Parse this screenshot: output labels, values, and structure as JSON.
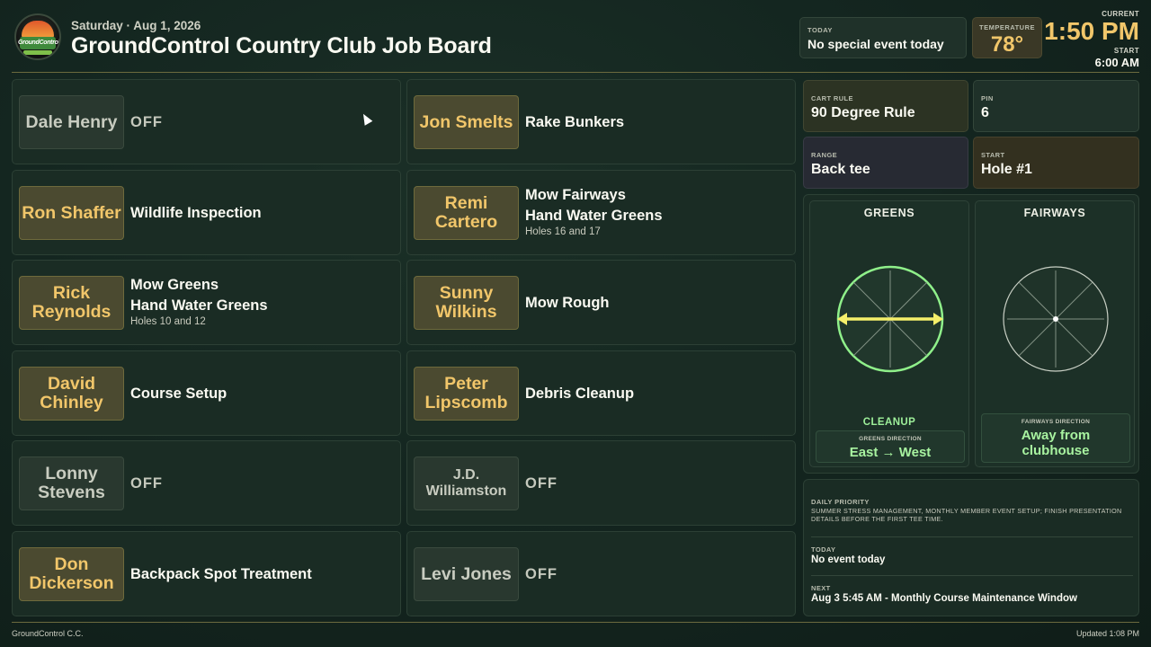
{
  "header": {
    "date": "Saturday · Aug 1, 2026",
    "title": "GroundControl Country Club Job Board",
    "logo_text": "GroundControl",
    "today_label": "TODAY",
    "today_value": "No special event today",
    "temperature_label": "TEMPERATURE",
    "temperature_value": "78°",
    "current_label": "CURRENT",
    "current_time": "1:50 PM",
    "start_label": "START",
    "start_time": "6:00 AM"
  },
  "colors": {
    "accent_gold": "#f1c66a",
    "accent_green": "#9ef09a",
    "background": "#142620"
  },
  "jobs": [
    {
      "name": "Dale Henry",
      "status": "off",
      "tasks": [
        "OFF"
      ],
      "note": ""
    },
    {
      "name": "Jon Smelts",
      "status": "on",
      "tasks": [
        "Rake Bunkers"
      ],
      "note": ""
    },
    {
      "name": "Ron Shaffer",
      "status": "on",
      "tasks": [
        "Wildlife Inspection"
      ],
      "note": ""
    },
    {
      "name": "Remi Cartero",
      "status": "on",
      "tasks": [
        "Mow Fairways",
        "Hand Water Greens"
      ],
      "note": "Holes 16 and 17"
    },
    {
      "name": "Rick Reynolds",
      "status": "on",
      "tasks": [
        "Mow Greens",
        "Hand Water Greens"
      ],
      "note": "Holes 10 and 12"
    },
    {
      "name": "Sunny Wilkins",
      "status": "on",
      "tasks": [
        "Mow Rough"
      ],
      "note": ""
    },
    {
      "name": "David Chinley",
      "status": "on",
      "tasks": [
        "Course Setup"
      ],
      "note": ""
    },
    {
      "name": "Peter Lipscomb",
      "status": "on",
      "tasks": [
        "Debris Cleanup"
      ],
      "note": ""
    },
    {
      "name": "Lonny Stevens",
      "status": "off",
      "tasks": [
        "OFF"
      ],
      "note": ""
    },
    {
      "name": "J.D. Williamston",
      "status": "off",
      "tasks": [
        "OFF"
      ],
      "note": ""
    },
    {
      "name": "Don Dickerson",
      "status": "on",
      "tasks": [
        "Backpack Spot Treatment"
      ],
      "note": ""
    },
    {
      "name": "Levi Jones",
      "status": "off",
      "tasks": [
        "OFF"
      ],
      "note": ""
    }
  ],
  "info": {
    "cart_rule_label": "CART RULE",
    "cart_rule_value": "90 Degree Rule",
    "pin_label": "PIN",
    "pin_value": "6",
    "range_label": "RANGE",
    "range_value": "Back tee",
    "start_label": "START",
    "start_value": "Hole #1"
  },
  "directions": {
    "greens_title": "GREENS",
    "greens_status": "CLEANUP",
    "greens_dir_label": "GREENS DIRECTION",
    "greens_dir_value": "East → West",
    "fairways_title": "FAIRWAYS",
    "fairways_dir_label": "FAIRWAYS DIRECTION",
    "fairways_dir_value": "Away from clubhouse"
  },
  "notes": {
    "daily_priority_label": "DAILY PRIORITY",
    "daily_priority_value": "Summer stress management, monthly member event setup; finish presentation details before the first tee time.",
    "today_label": "TODAY",
    "today_value": "No event today",
    "next_label": "NEXT",
    "next_value": "Aug 3 5:45 AM - Monthly Course Maintenance Window"
  },
  "footer": {
    "left": "GroundControl C.C.",
    "right": "Updated 1:08 PM"
  }
}
